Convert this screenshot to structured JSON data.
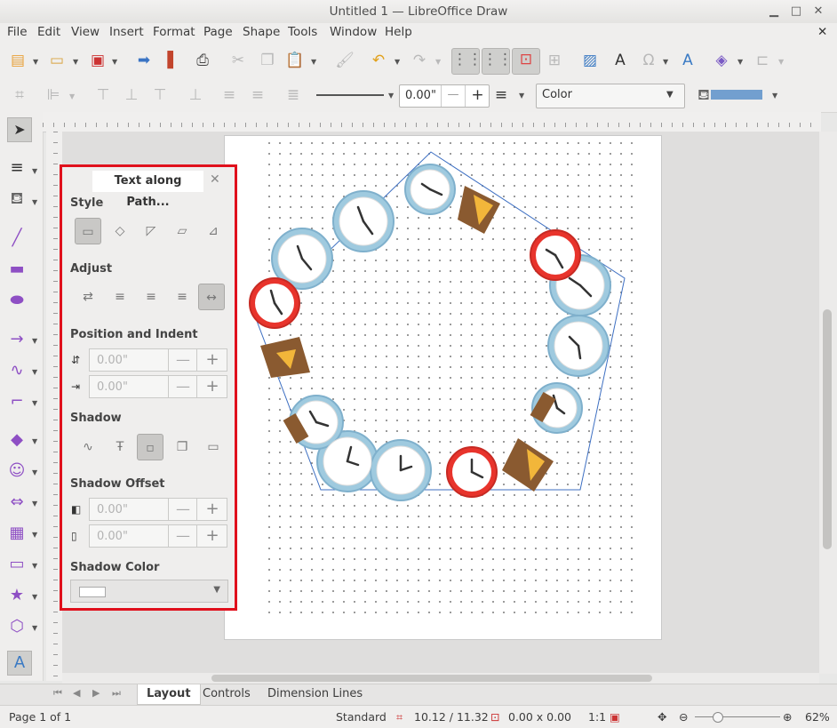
{
  "window": {
    "title": "Untitled 1 — LibreOffice Draw"
  },
  "menu": [
    "File",
    "Edit",
    "View",
    "Insert",
    "Format",
    "Page",
    "Shape",
    "Tools",
    "Window",
    "Help"
  ],
  "toolbar2": {
    "line_width": "0.00\"",
    "fill_type": "Color",
    "minus": "—",
    "plus": "+"
  },
  "panel": {
    "title": "Text along Path...",
    "sections": {
      "style": "Style",
      "adjust": "Adjust",
      "position": "Position and Indent",
      "shadow": "Shadow",
      "shadow_offset": "Shadow Offset",
      "shadow_color": "Shadow Color"
    },
    "position_distance": "0.00\"",
    "position_indent": "0.00\"",
    "shadow_offset_x": "0.00\"",
    "shadow_offset_y": "0.00\"",
    "spin_minus": "—",
    "spin_plus": "+"
  },
  "tabs": [
    "Layout",
    "Controls",
    "Dimension Lines"
  ],
  "status": {
    "page": "Page 1 of 1",
    "layout": "Standard",
    "position": "10.12 / 11.32",
    "size": "0.00 x 0.00",
    "scale": "1:1",
    "zoom": "62%"
  },
  "colors": {
    "accent": "#e0101c",
    "line_color": "#729fcf"
  }
}
